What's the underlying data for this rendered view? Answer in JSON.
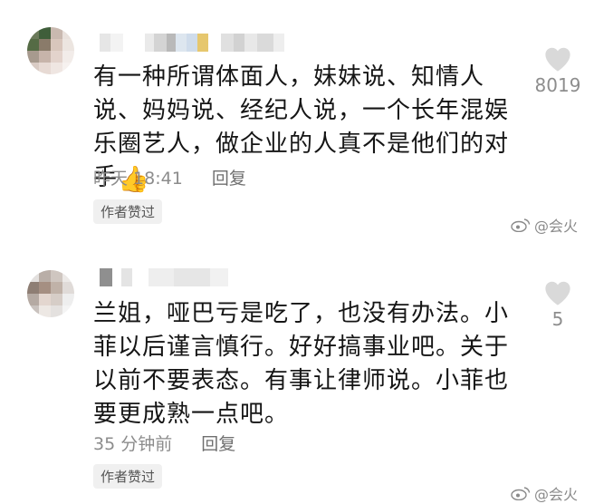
{
  "comments": [
    {
      "text": "有一种所谓体面人，妹妹说、知情人说、妈妈说、经纪人说，一个长年混娱乐圈艺人，做企业的人真不是他们的对手",
      "emoji": "👍",
      "time": "昨天 18:41",
      "reply_label": "回复",
      "badge": "作者赞过",
      "likes": "8019",
      "icon": "heart-icon"
    },
    {
      "text": "兰姐，哑巴亏是吃了，也没有办法。小菲以后谨言慎行。好好搞事业吧。关于以前不要表态。有事让律师说。小菲也要更成熟一点吧。",
      "time": "35 分钟前",
      "reply_label": "回复",
      "badge": "作者赞过",
      "likes": "5",
      "icon": "heart-icon"
    }
  ],
  "watermark": {
    "text": "@会火",
    "icon": "weibo-logo-icon"
  },
  "colors": {
    "like_heart": "#d9d9d9",
    "meta": "#8c8c8c",
    "badge_bg": "#f0f0f0"
  }
}
